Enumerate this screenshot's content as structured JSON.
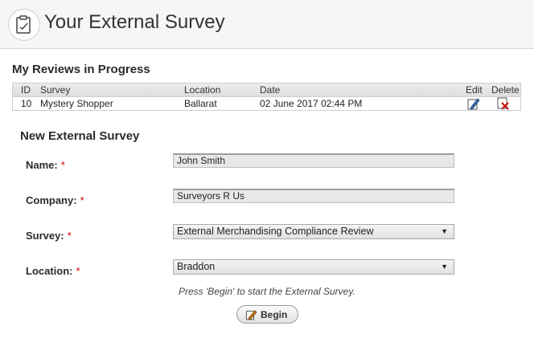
{
  "app": {
    "title": "Your External Survey",
    "logo_icon": "clipboard-icon"
  },
  "reviews": {
    "section_title": "My Reviews in Progress",
    "columns": [
      "ID",
      "Survey",
      "Location",
      "Date",
      "Edit",
      "Delete"
    ],
    "rows": [
      {
        "id": "10",
        "survey": "Mystery Shopper",
        "location": "Ballarat",
        "date": "02 June 2017 02:44 PM"
      }
    ]
  },
  "form": {
    "title": "New External Survey",
    "name_label": "Name:",
    "name_value": "John Smith",
    "company_label": "Company:",
    "company_value": "Surveyors R Us",
    "survey_label": "Survey:",
    "survey_value": "External Merchandising Compliance Review",
    "location_label": "Location:",
    "location_value": "Braddon",
    "required_mark": "*",
    "hint": "Press 'Begin' to start the External Survey.",
    "begin_label": "Begin"
  },
  "colors": {
    "required": "#cc0000",
    "header_bg": "#f6f6f6"
  }
}
